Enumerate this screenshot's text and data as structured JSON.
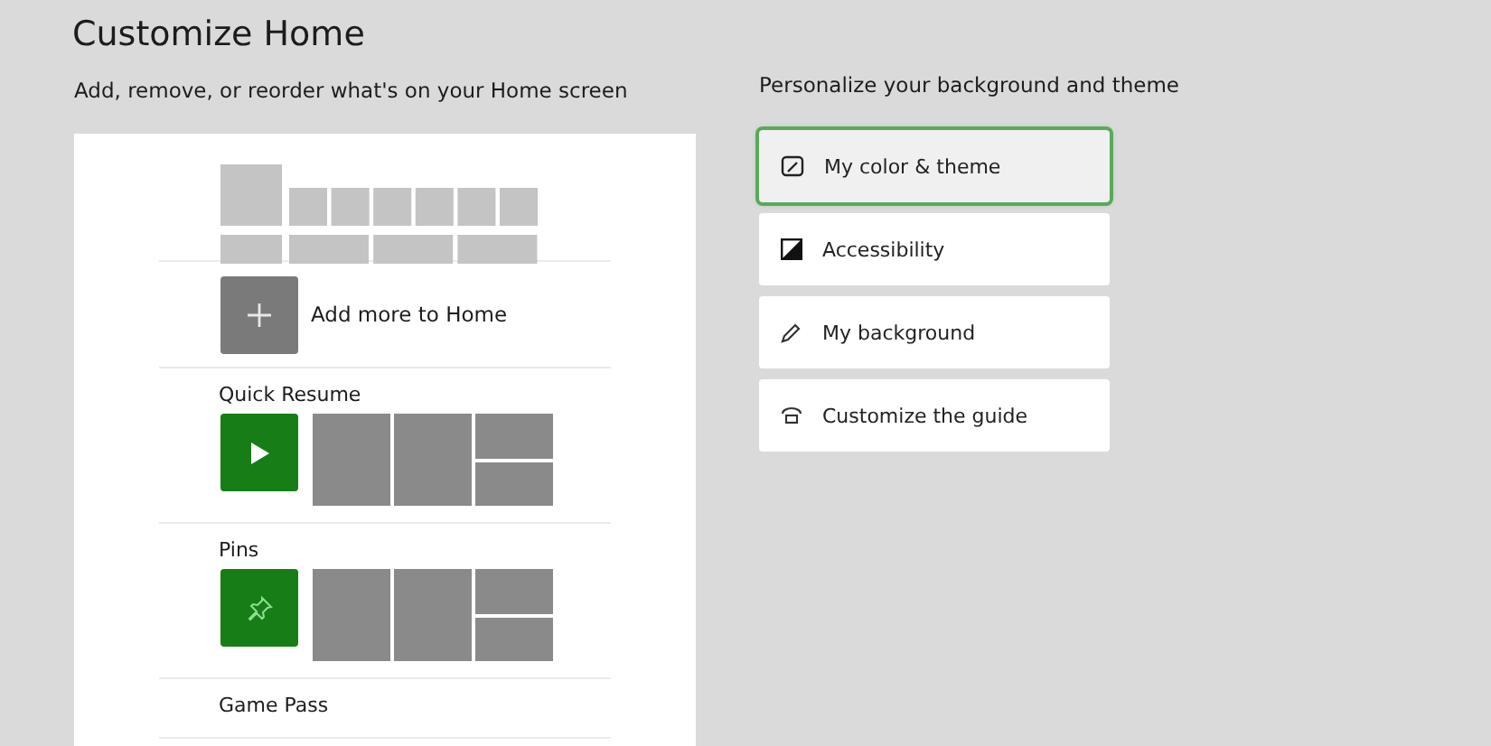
{
  "title": "Customize Home",
  "subtitle": "Add, remove, or reorder what's on your Home screen",
  "add_more": {
    "label": "Add more to Home"
  },
  "sections": [
    {
      "title": "Quick Resume",
      "kind": "play"
    },
    {
      "title": "Pins",
      "kind": "pin"
    },
    {
      "title": "Game Pass",
      "kind": "cut"
    }
  ],
  "personalize": {
    "heading": "Personalize your background and theme",
    "options": [
      {
        "label": "My color & theme",
        "kind": "palette",
        "selected": true
      },
      {
        "label": "Accessibility",
        "kind": "contrast",
        "selected": false
      },
      {
        "label": "My background",
        "kind": "pencil",
        "selected": false
      },
      {
        "label": "Customize the guide",
        "kind": "guide",
        "selected": false
      }
    ]
  }
}
